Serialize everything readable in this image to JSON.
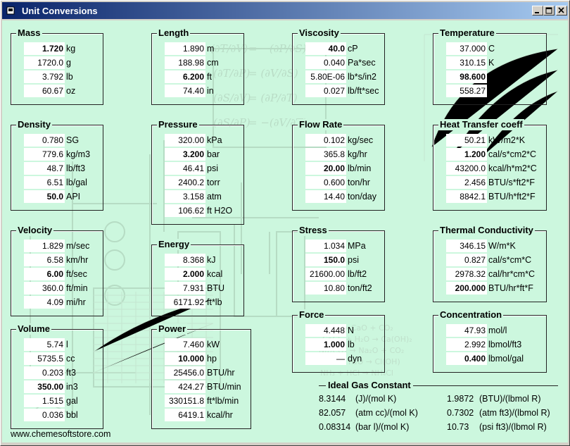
{
  "window": {
    "title": "Unit Conversions"
  },
  "groups": {
    "mass": {
      "title": "Mass",
      "rows": [
        {
          "value": "1.720",
          "unit": "kg",
          "bold": true
        },
        {
          "value": "1720.0",
          "unit": "g"
        },
        {
          "value": "3.792",
          "unit": "lb"
        },
        {
          "value": "60.67",
          "unit": "oz"
        }
      ]
    },
    "length": {
      "title": "Length",
      "rows": [
        {
          "value": "1.890",
          "unit": "m"
        },
        {
          "value": "188.98",
          "unit": "cm"
        },
        {
          "value": "6.200",
          "unit": "ft",
          "bold": true
        },
        {
          "value": "74.40",
          "unit": "in"
        }
      ]
    },
    "viscosity": {
      "title": "Viscosity",
      "rows": [
        {
          "value": "40.0",
          "unit": "cP",
          "bold": true
        },
        {
          "value": "0.040",
          "unit": "Pa*sec"
        },
        {
          "value": "5.80E-06",
          "unit": "lb*s/in2"
        },
        {
          "value": "0.027",
          "unit": "lb/ft*sec"
        }
      ]
    },
    "temperature": {
      "title": "Temperature",
      "rows": [
        {
          "value": "37.000",
          "unit": "C"
        },
        {
          "value": "310.15",
          "unit": "K"
        },
        {
          "value": "98.600",
          "unit": "F",
          "bold": true
        },
        {
          "value": "558.27",
          "unit": "R"
        }
      ]
    },
    "density": {
      "title": "Density",
      "rows": [
        {
          "value": "0.780",
          "unit": "SG"
        },
        {
          "value": "779.6",
          "unit": "kg/m3"
        },
        {
          "value": "48.7",
          "unit": "lb/ft3"
        },
        {
          "value": "6.51",
          "unit": "lb/gal"
        },
        {
          "value": "50.0",
          "unit": "API",
          "bold": true
        }
      ]
    },
    "pressure": {
      "title": "Pressure",
      "rows": [
        {
          "value": "320.00",
          "unit": "kPa"
        },
        {
          "value": "3.200",
          "unit": "bar",
          "bold": true
        },
        {
          "value": "46.41",
          "unit": "psi"
        },
        {
          "value": "2400.2",
          "unit": "torr"
        },
        {
          "value": "3.158",
          "unit": "atm"
        },
        {
          "value": "106.62",
          "unit": "ft H2O"
        }
      ]
    },
    "flowrate": {
      "title": "Flow Rate",
      "rows": [
        {
          "value": "0.102",
          "unit": "kg/sec"
        },
        {
          "value": "365.8",
          "unit": "kg/hr"
        },
        {
          "value": "20.00",
          "unit": "lb/min",
          "bold": true
        },
        {
          "value": "0.600",
          "unit": "ton/hr"
        },
        {
          "value": "14.40",
          "unit": "ton/day"
        }
      ]
    },
    "heattransfer": {
      "title": "Heat Transfer coeff",
      "rows": [
        {
          "value": "50.21",
          "unit": "kW/m2*K"
        },
        {
          "value": "1.200",
          "unit": "cal/s*cm2*C",
          "bold": true
        },
        {
          "value": "43200.0",
          "unit": "kcal/h*m2*C"
        },
        {
          "value": "2.456",
          "unit": "BTU/s*ft2*F"
        },
        {
          "value": "8842.1",
          "unit": "BTU/h*ft2*F"
        }
      ]
    },
    "velocity": {
      "title": "Velocity",
      "rows": [
        {
          "value": "1.829",
          "unit": "m/sec"
        },
        {
          "value": "6.58",
          "unit": "km/hr"
        },
        {
          "value": "6.00",
          "unit": "ft/sec",
          "bold": true
        },
        {
          "value": "360.0",
          "unit": "ft/min"
        },
        {
          "value": "4.09",
          "unit": "mi/hr"
        }
      ]
    },
    "energy": {
      "title": "Energy",
      "rows": [
        {
          "value": "8.368",
          "unit": "kJ"
        },
        {
          "value": "2.000",
          "unit": "kcal",
          "bold": true
        },
        {
          "value": "7.931",
          "unit": "BTU"
        },
        {
          "value": "6171.92",
          "unit": "ft*lb"
        }
      ]
    },
    "stress": {
      "title": "Stress",
      "rows": [
        {
          "value": "1.034",
          "unit": "MPa"
        },
        {
          "value": "150.0",
          "unit": "psi",
          "bold": true
        },
        {
          "value": "21600.00",
          "unit": "lb/ft2"
        },
        {
          "value": "10.80",
          "unit": "ton/ft2"
        }
      ]
    },
    "thermal": {
      "title": "Thermal Conductivity",
      "rows": [
        {
          "value": "346.15",
          "unit": "W/m*K"
        },
        {
          "value": "0.827",
          "unit": "cal/s*cm*C"
        },
        {
          "value": "2978.32",
          "unit": "cal/hr*cm*C"
        },
        {
          "value": "200.000",
          "unit": "BTU/hr*ft*F",
          "bold": true
        }
      ]
    },
    "volume": {
      "title": "Volume",
      "rows": [
        {
          "value": "5.74",
          "unit": "l"
        },
        {
          "value": "5735.5",
          "unit": "cc"
        },
        {
          "value": "0.203",
          "unit": "ft3"
        },
        {
          "value": "350.00",
          "unit": "in3",
          "bold": true
        },
        {
          "value": "1.515",
          "unit": "gal"
        },
        {
          "value": "0.036",
          "unit": "bbl"
        }
      ]
    },
    "power": {
      "title": "Power",
      "rows": [
        {
          "value": "7.460",
          "unit": "kW"
        },
        {
          "value": "10.000",
          "unit": "hp",
          "bold": true
        },
        {
          "value": "25456.0",
          "unit": "BTU/hr"
        },
        {
          "value": "424.27",
          "unit": "BTU/min"
        },
        {
          "value": "330151.8",
          "unit": "ft*lb/min"
        },
        {
          "value": "6419.1",
          "unit": "kcal/hr"
        }
      ]
    },
    "force": {
      "title": "Force",
      "rows": [
        {
          "value": "4.448",
          "unit": "N"
        },
        {
          "value": "1.000",
          "unit": "lb",
          "bold": true
        },
        {
          "value": "—",
          "unit": "dyn"
        }
      ]
    },
    "concentration": {
      "title": "Concentration",
      "rows": [
        {
          "value": "47.93",
          "unit": "mol/l"
        },
        {
          "value": "2.992",
          "unit": "lbmol/ft3"
        },
        {
          "value": "0.400",
          "unit": "lbmol/gal",
          "bold": true
        }
      ]
    }
  },
  "ideal_gas": {
    "title": "Ideal Gas Constant",
    "items": [
      {
        "value": "8.3144",
        "unit": "(J)/(mol K)"
      },
      {
        "value": "1.9872",
        "unit": "(BTU)/(lbmol R)"
      },
      {
        "value": "82.057",
        "unit": "(atm cc)/(mol K)"
      },
      {
        "value": "0.7302",
        "unit": "(atm ft3)/(lbmol R)"
      },
      {
        "value": "0.08314",
        "unit": "(bar l)/(mol K)"
      },
      {
        "value": "10.73",
        "unit": "(psi ft3)/(lbmol R)"
      }
    ]
  },
  "footer": {
    "website": "www.chemesoftstore.com"
  },
  "background": {
    "formula_fragments": [
      "(∂T/∂V)",
      "= −(∂P/∂S)",
      "= (∂P/∂V)",
      "(∂S/∂V)",
      "(∂T/∂P)",
      "= (∂V/∂S)"
    ]
  }
}
